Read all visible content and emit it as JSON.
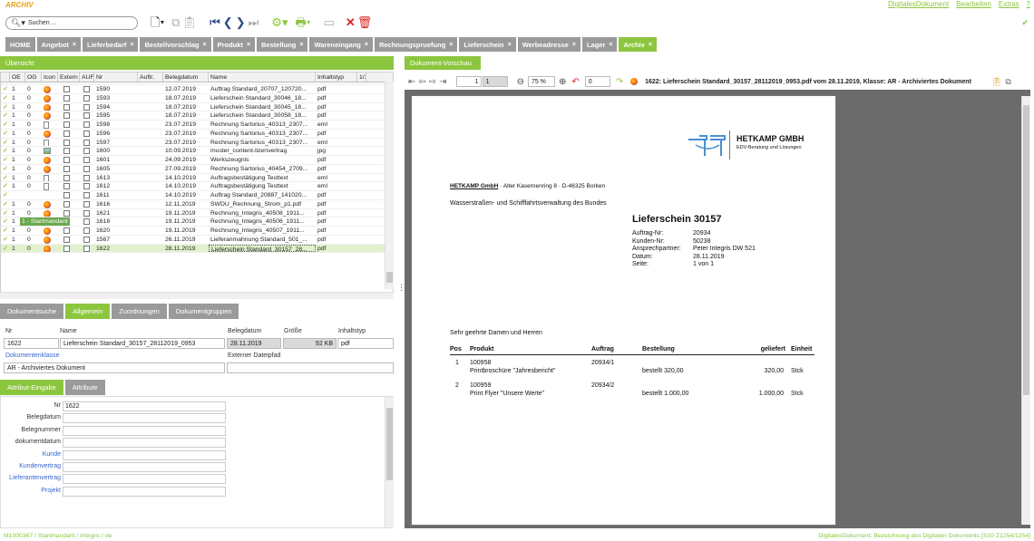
{
  "app": {
    "title": "ARCHIV"
  },
  "menu": [
    "DigitalesDokument",
    "Bearbeiten",
    "Extras",
    "?"
  ],
  "search": {
    "placeholder": "Suchen ..."
  },
  "tabs": [
    {
      "label": "HOME",
      "closable": false
    },
    {
      "label": "Angebot",
      "closable": true
    },
    {
      "label": "Lieferbedarf",
      "closable": true
    },
    {
      "label": "Bestellvorschlag",
      "closable": true
    },
    {
      "label": "Produkt",
      "closable": true
    },
    {
      "label": "Bestellung",
      "closable": true
    },
    {
      "label": "Wareneingang",
      "closable": true
    },
    {
      "label": "Rechnungspruefung",
      "closable": true
    },
    {
      "label": "Lieferschein",
      "closable": true
    },
    {
      "label": "Werbeadresse",
      "closable": true
    },
    {
      "label": "Lager",
      "closable": true
    },
    {
      "label": "Archiv",
      "closable": true,
      "active": true
    }
  ],
  "left_header": "Übersicht",
  "grid": {
    "columns": [
      "",
      "OE",
      "OG",
      "Icon",
      "Extern",
      "AUF",
      "Nr",
      "Auftr.",
      "Belegdatum",
      "Name",
      "Inhaltstyp",
      "1/1"
    ],
    "rows": [
      {
        "oe": "1",
        "og": "0",
        "icon": "pdf",
        "nr": "1590",
        "date": "12.07.2019",
        "name": "Auftrag Standard_20707_120720...",
        "type": "pdf"
      },
      {
        "oe": "1",
        "og": "0",
        "icon": "pdf",
        "nr": "1593",
        "date": "18.07.2019",
        "name": "Lieferschein Standard_30046_18...",
        "type": "pdf"
      },
      {
        "oe": "1",
        "og": "0",
        "icon": "pdf",
        "nr": "1594",
        "date": "18.07.2019",
        "name": "Lieferschein Standard_30045_18...",
        "type": "pdf"
      },
      {
        "oe": "1",
        "og": "0",
        "icon": "pdf",
        "nr": "1595",
        "date": "18.07.2019",
        "name": "Lieferschein Standard_30058_18...",
        "type": "pdf"
      },
      {
        "oe": "1",
        "og": "0",
        "icon": "doc",
        "nr": "1598",
        "date": "23.07.2019",
        "name": "Rechnung Sartorius_40313_2307...",
        "type": "eml"
      },
      {
        "oe": "1",
        "og": "0",
        "icon": "pdf",
        "nr": "1596",
        "date": "23.07.2019",
        "name": "Rechnung Sartorius_40313_2307...",
        "type": "pdf"
      },
      {
        "oe": "1",
        "og": "0",
        "icon": "doc",
        "nr": "1597",
        "date": "23.07.2019",
        "name": "Rechnung Sartorius_40313_2307...",
        "type": "eml"
      },
      {
        "oe": "1",
        "og": "0",
        "icon": "img",
        "nr": "1600",
        "date": "10.09.2019",
        "name": "muster_content-lizenvertrag",
        "type": "jpg"
      },
      {
        "oe": "1",
        "og": "0",
        "icon": "pdf",
        "nr": "1601",
        "date": "24.09.2019",
        "name": "Werkszeugnis",
        "type": "pdf"
      },
      {
        "oe": "1",
        "og": "0",
        "icon": "pdf",
        "nr": "1605",
        "date": "27.09.2019",
        "name": "Rechnung Sartorius_40454_2709...",
        "type": "pdf"
      },
      {
        "oe": "1",
        "og": "0",
        "icon": "doc",
        "nr": "1613",
        "date": "14.10.2019",
        "name": "Auftragsbestätigung Testtext",
        "type": "eml"
      },
      {
        "oe": "1",
        "og": "0",
        "icon": "doc",
        "nr": "1612",
        "date": "14.10.2019",
        "name": "Auftragsbestätigung Testtext",
        "type": "eml"
      },
      {
        "oe": "",
        "og": "",
        "icon": "",
        "nr": "1611",
        "date": "14.10.2019",
        "name": "Auftrag Standard_20887_141020...",
        "type": "pdf"
      },
      {
        "oe": "1",
        "og": "0",
        "icon": "pdf",
        "nr": "1616",
        "date": "12.11.2019",
        "name": "SWDU_Rechnung_Strom_p1.pdf",
        "type": "pdf"
      },
      {
        "oe": "1",
        "og": "0",
        "icon": "pdf",
        "nr": "1621",
        "date": "19.11.2019",
        "name": "Rechnung_Integris_40508_1911...",
        "type": "pdf"
      },
      {
        "oe": "1",
        "og": "0",
        "icon": "pdf",
        "nr": "1618",
        "date": "19.11.2019",
        "name": "Rechnung_Integris_40506_1911...",
        "type": "pdf"
      },
      {
        "oe": "1",
        "og": "0",
        "icon": "pdf",
        "nr": "1620",
        "date": "19.11.2019",
        "name": "Rechnung_Integris_40507_1911...",
        "type": "pdf"
      },
      {
        "oe": "1",
        "og": "0",
        "icon": "pdf",
        "nr": "1567",
        "date": "26.11.2019",
        "name": "Lieferanmahnung Standard_501_...",
        "type": "pdf"
      },
      {
        "oe": "1",
        "og": "0",
        "icon": "pdf",
        "nr": "1622",
        "date": "28.11.2019",
        "name": "Lieferschein Standard_30157_28...",
        "type": "pdf",
        "selected": true
      }
    ],
    "tooltip": "1 - Startmandant"
  },
  "detail_tabs": [
    "Dokumentsuche",
    "Allgemein",
    "Zuordnungen",
    "Dokumentgruppen"
  ],
  "detail": {
    "nr_label": "Nr",
    "nr_value": "1622",
    "name_label": "Name",
    "name_value": "Lieferschein Standard_30157_28112019_0953",
    "belegdatum_label": "Belegdatum",
    "belegdatum_value": "28.11.2019",
    "groesse_label": "Größe",
    "groesse_value": "92 KB",
    "inhaltstyp_label": "Inhaltstyp",
    "inhaltstyp_value": "pdf",
    "klasse_label": "Dokumentenklasse",
    "klasse_value": "AR - Archiviertes Dokument",
    "pfad_label": "Externer Dateipfad"
  },
  "attr_tabs": [
    "Attribut-Eingabe",
    "Attribute"
  ],
  "attributes": [
    {
      "label": "Nr",
      "value": "1622",
      "link": false
    },
    {
      "label": "Belegdatum",
      "value": "",
      "link": false
    },
    {
      "label": "Belegnummer",
      "value": "",
      "link": false
    },
    {
      "label": "dokumentdatum",
      "value": "",
      "link": false
    },
    {
      "label": "Kunde",
      "value": "",
      "link": true
    },
    {
      "label": "Kundenvertrag",
      "value": "",
      "link": true
    },
    {
      "label": "Lieferantenvertrag",
      "value": "",
      "link": true
    },
    {
      "label": "Projekt",
      "value": "",
      "link": true
    }
  ],
  "preview": {
    "header": "Dokument-Vorschau",
    "page_current": "1",
    "page_total": "1",
    "zoom": "75 %",
    "rotate": "0",
    "title": "1622: Lieferschein Standard_30157_28112019_0953.pdf vom 28.11.2019, Klasse: AR - Archiviertes Dokument"
  },
  "pdf": {
    "logo_name": "HETKAMP GMBH",
    "logo_sub": "EDV-Beratung und Lösungen",
    "sender": "HETKAMP GmbH",
    "sender_rest": " · Alter Kasernenring 8 · D-46325 Borken",
    "recipient": "Wasserstraßen- und Schifffahrtsverwaltung des Bundes",
    "doc_title": "Lieferschein 30157",
    "meta": [
      {
        "k": "Auftrag-Nr:",
        "v": "20934"
      },
      {
        "k": "Kunden-Nr:",
        "v": "50238"
      },
      {
        "k": "Ansprechpartner:",
        "v": "Peter Integris DW 521"
      },
      {
        "k": "Datum:",
        "v": "28.11.2019"
      },
      {
        "k": "Seite:",
        "v": "1 von 1"
      }
    ],
    "greeting": "Sehr geehrte Damen und Herren",
    "table_headers": [
      "Pos",
      "Produkt",
      "Auftrag",
      "Bestellung",
      "geliefert",
      "Einheit"
    ],
    "items": [
      {
        "pos": "1",
        "code": "100958",
        "desc": "Printbroschüre \"Jahresbericht\"",
        "auftrag": "20934/1",
        "bestellung": "bestellt 320,00",
        "geliefert": "320,00",
        "einheit": "Stck"
      },
      {
        "pos": "2",
        "code": "100959",
        "desc": "Print Flyer \"Unsere Werte\"",
        "auftrag": "20934/2",
        "bestellung": "bestellt 1.000,00",
        "geliefert": "1.000,00",
        "einheit": "Stck"
      }
    ]
  },
  "status": {
    "left": "M1000367 / Startmandant / integris / de",
    "right": "DigitalesDokument: Bezeichnung des Digitalen Dokuments [S10 Z1254/1254]"
  }
}
